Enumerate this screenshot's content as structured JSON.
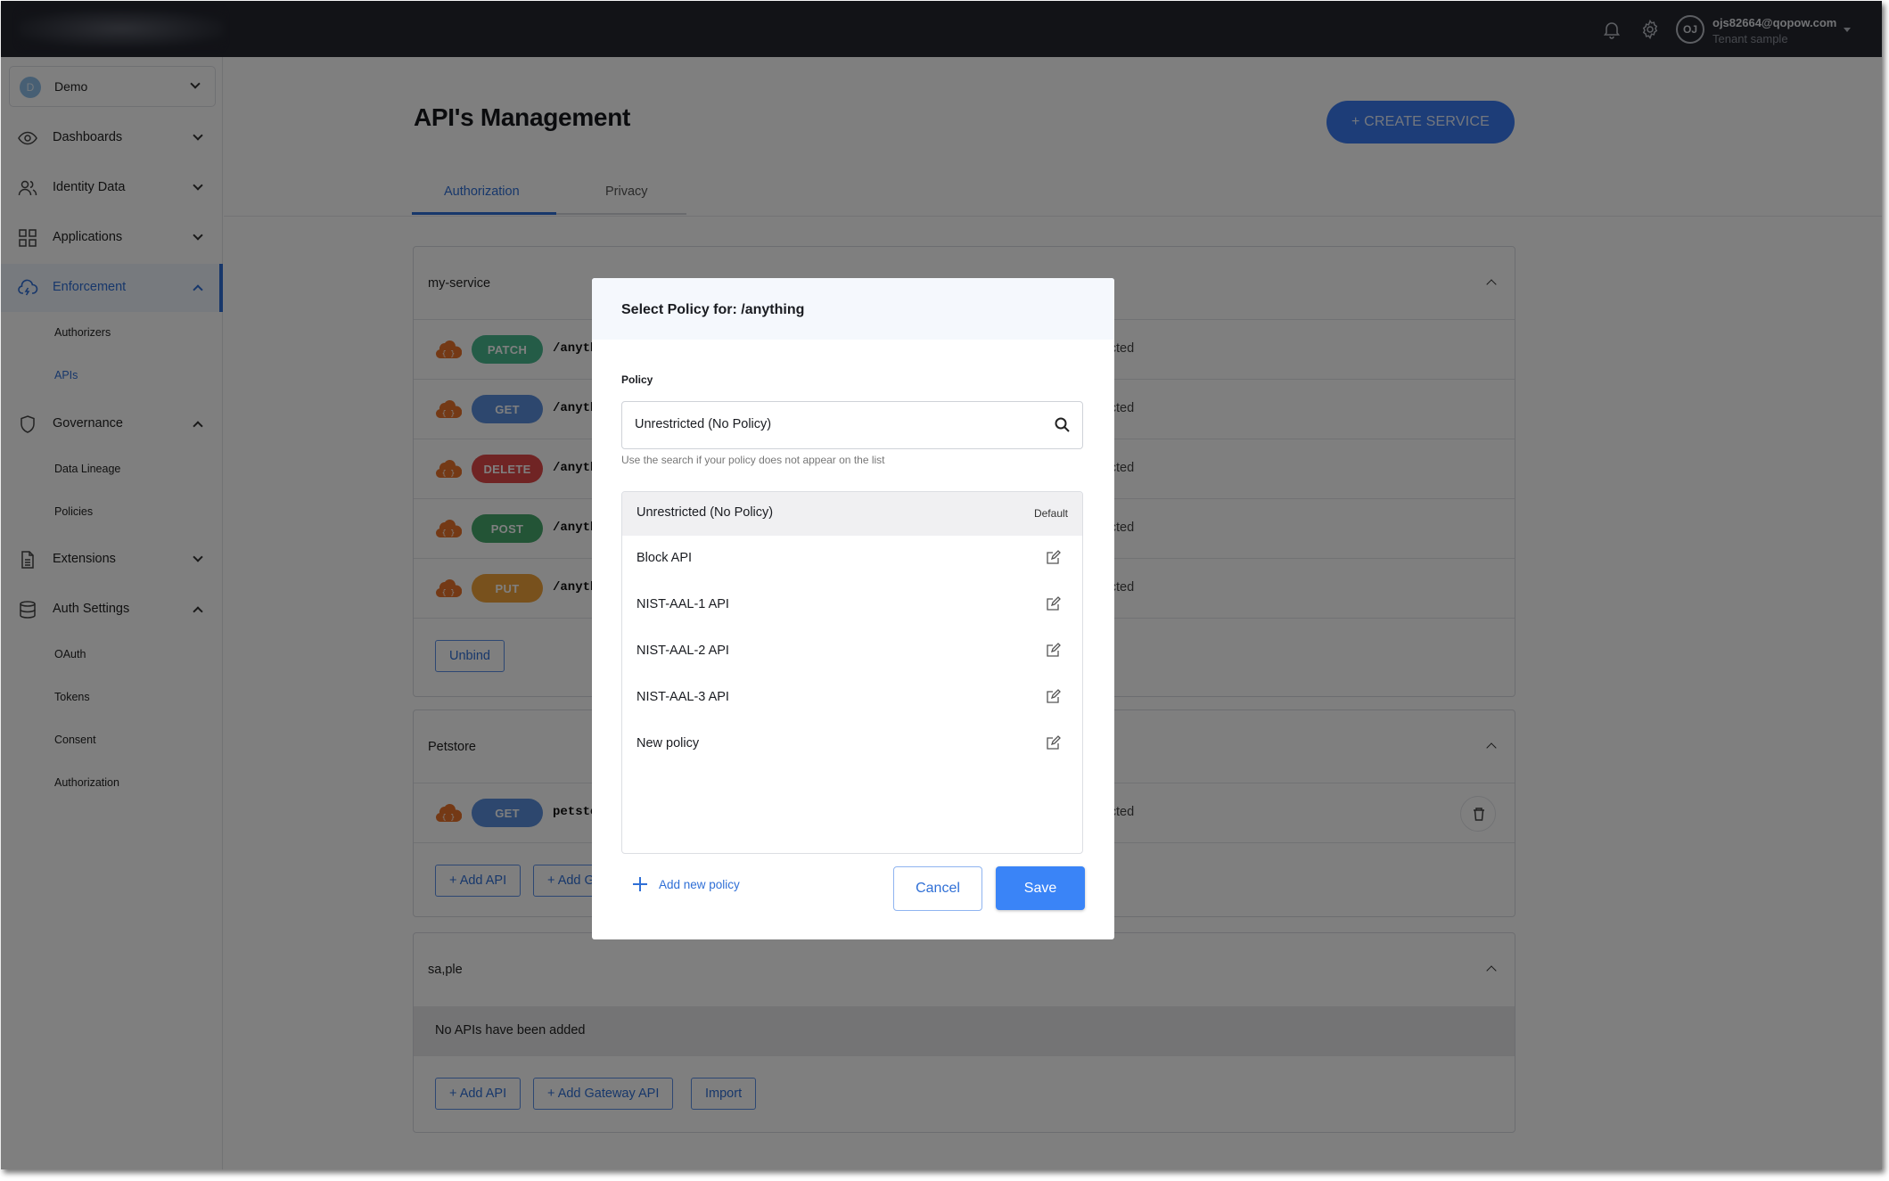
{
  "topbar": {
    "user_initials": "OJ",
    "user_email": "ojs82664@qopow.com",
    "tenant_label": "Tenant sample",
    "icons": [
      "bell-icon",
      "gear-icon"
    ]
  },
  "sidebar": {
    "tenant": {
      "initial": "D",
      "name": "Demo"
    },
    "items": [
      {
        "label": "Dashboards",
        "icon": "eye-icon",
        "expanded": false
      },
      {
        "label": "Identity Data",
        "icon": "users-icon",
        "expanded": false
      },
      {
        "label": "Applications",
        "icon": "grid-icon",
        "expanded": false
      },
      {
        "label": "Enforcement",
        "icon": "cloud-bolt-icon",
        "expanded": true,
        "active": true,
        "children": [
          {
            "label": "Authorizers"
          },
          {
            "label": "APIs",
            "active": true
          }
        ]
      },
      {
        "label": "Governance",
        "icon": "shield-icon",
        "expanded": true,
        "children": [
          {
            "label": "Data Lineage"
          },
          {
            "label": "Policies"
          }
        ]
      },
      {
        "label": "Extensions",
        "icon": "document-icon",
        "expanded": false
      },
      {
        "label": "Auth Settings",
        "icon": "database-icon",
        "expanded": true,
        "children": [
          {
            "label": "OAuth"
          },
          {
            "label": "Tokens"
          },
          {
            "label": "Consent"
          },
          {
            "label": "Authorization"
          }
        ]
      }
    ]
  },
  "main": {
    "title": "API's Management",
    "create_button": "+ CREATE SERVICE",
    "tabs": [
      {
        "label": "Authorization",
        "active": true
      },
      {
        "label": "Privacy",
        "active": false
      }
    ],
    "services": [
      {
        "name": "my-service",
        "apis": [
          {
            "method": "PATCH",
            "path": "/anything",
            "policy": "Unrestricted"
          },
          {
            "method": "GET",
            "path": "/anything",
            "policy": "Unrestricted"
          },
          {
            "method": "DELETE",
            "path": "/anything",
            "policy": "Unrestricted"
          },
          {
            "method": "POST",
            "path": "/anything",
            "policy": "Unrestricted"
          },
          {
            "method": "PUT",
            "path": "/anything",
            "policy": "Unrestricted"
          }
        ],
        "actions": [
          "Unbind"
        ]
      },
      {
        "name": "Petstore",
        "apis": [
          {
            "method": "GET",
            "path": "petstore",
            "policy": "Unrestricted"
          }
        ],
        "actions": [
          "+ Add API",
          "+ Add Gateway API"
        ]
      },
      {
        "name": "sa,ple",
        "apis": [],
        "empty_text": "No APIs have been added",
        "actions": [
          "+ Add API",
          "+ Add Gateway API",
          "Import"
        ]
      }
    ],
    "method_colors": {
      "PATCH": "#49b98f",
      "GET": "#5b8fdc",
      "DELETE": "#e04848",
      "POST": "#47a86c",
      "PUT": "#f0a33a"
    }
  },
  "modal": {
    "title": "Select Policy for: /anything",
    "field_label": "Policy",
    "search_value": "Unrestricted (No Policy)",
    "helper_text": "Use the search if your policy does not appear on the list",
    "policies": [
      {
        "name": "Unrestricted (No Policy)",
        "badge": "Default",
        "selected": true
      },
      {
        "name": "Block API"
      },
      {
        "name": "NIST-AAL-1 API"
      },
      {
        "name": "NIST-AAL-2 API"
      },
      {
        "name": "NIST-AAL-3 API"
      },
      {
        "name": "New policy"
      }
    ],
    "add_policy_label": "Add new policy",
    "cancel_label": "Cancel",
    "save_label": "Save"
  },
  "colors": {
    "accent": "#2f6fd6",
    "primary_button": "#3a84f7",
    "topbar": "#24262f"
  }
}
